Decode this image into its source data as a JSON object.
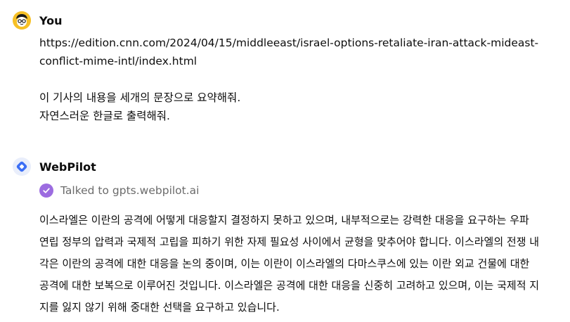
{
  "user_message": {
    "author": "You",
    "avatar_icon": "user-avatar-face",
    "url_line1": "https://edition.cnn.com/2024/04/15/middleeast/israel-options-retaliate-iran-attack-mideast-",
    "url_line2": "conflict-mime-intl/index.html",
    "instruction_line1": "이 기사의 내용을 세개의 문장으로 요약해줘.",
    "instruction_line2": "자연스러운 한글로 출력해줘."
  },
  "bot_message": {
    "author": "WebPilot",
    "avatar_icon": "webpilot-logo",
    "tool_status_icon": "check-circle-icon",
    "tool_status": "Talked to gpts.webpilot.ai",
    "answer_lines": [
      "이스라엘은 이란의 공격에 어떻게 대응할지 결정하지 못하고 있으며, 내부적으로는 강력한 대응을 요구하는 우파",
      "연립 정부의 압력과 국제적 고립을 피하기 위한 자제 필요성 사이에서 균형을 맞추어야 합니다. 이스라엘의 전쟁 내",
      "각은 이란의 공격에 대한 대응을 논의 중이며, 이는 이란이 이스라엘의 다마스쿠스에 있는 이란 외교 건물에 대한",
      "공격에 대한 보복으로 이루어진 것입니다. 이스라엘은 공격에 대한 대응을 신중히 고려하고 있으며, 이는 국제적 지",
      "지를 잃지 않기 위해 중대한 선택을 요구하고 있습니다."
    ]
  },
  "colors": {
    "user_avatar_bg": "#f6c026",
    "tool_check_bg": "#9c6ce0",
    "webpilot_blue": "#3b6ef5",
    "muted_text": "#6b6b6b"
  }
}
